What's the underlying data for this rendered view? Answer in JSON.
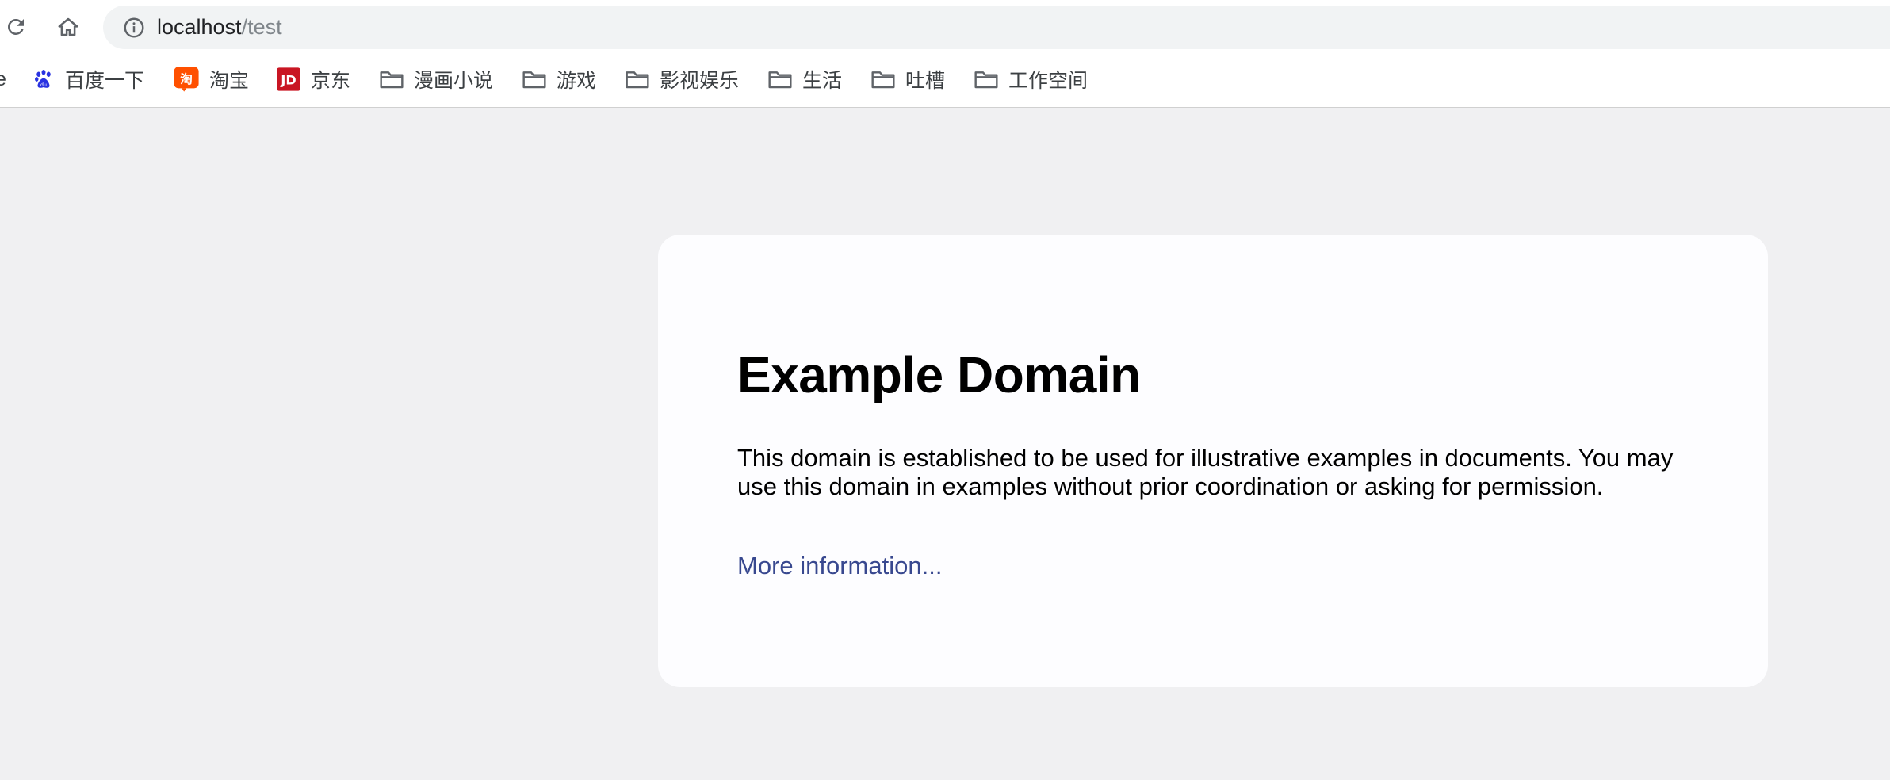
{
  "browser": {
    "url_host": "localhost",
    "url_path": "/test"
  },
  "bookmarks": [
    {
      "label": "e",
      "icon": "truncated"
    },
    {
      "label": "百度一下",
      "icon": "baidu-paw-icon"
    },
    {
      "label": "淘宝",
      "icon": "taobao-icon"
    },
    {
      "label": "京东",
      "icon": "jd-icon"
    },
    {
      "label": "漫画小说",
      "icon": "folder-icon"
    },
    {
      "label": "游戏",
      "icon": "folder-icon"
    },
    {
      "label": "影视娱乐",
      "icon": "folder-icon"
    },
    {
      "label": "生活",
      "icon": "folder-icon"
    },
    {
      "label": "吐槽",
      "icon": "folder-icon"
    },
    {
      "label": "工作空间",
      "icon": "folder-icon"
    }
  ],
  "page": {
    "title": "Example Domain",
    "body": "This domain is established to be used for illustrative examples in documents. You may use this domain in examples without prior coordination or asking for permission.",
    "link_text": "More information..."
  },
  "colors": {
    "background": "#f0f0f2",
    "card": "#fdfdff",
    "link": "#38488f",
    "omnibox": "#f1f3f4"
  }
}
